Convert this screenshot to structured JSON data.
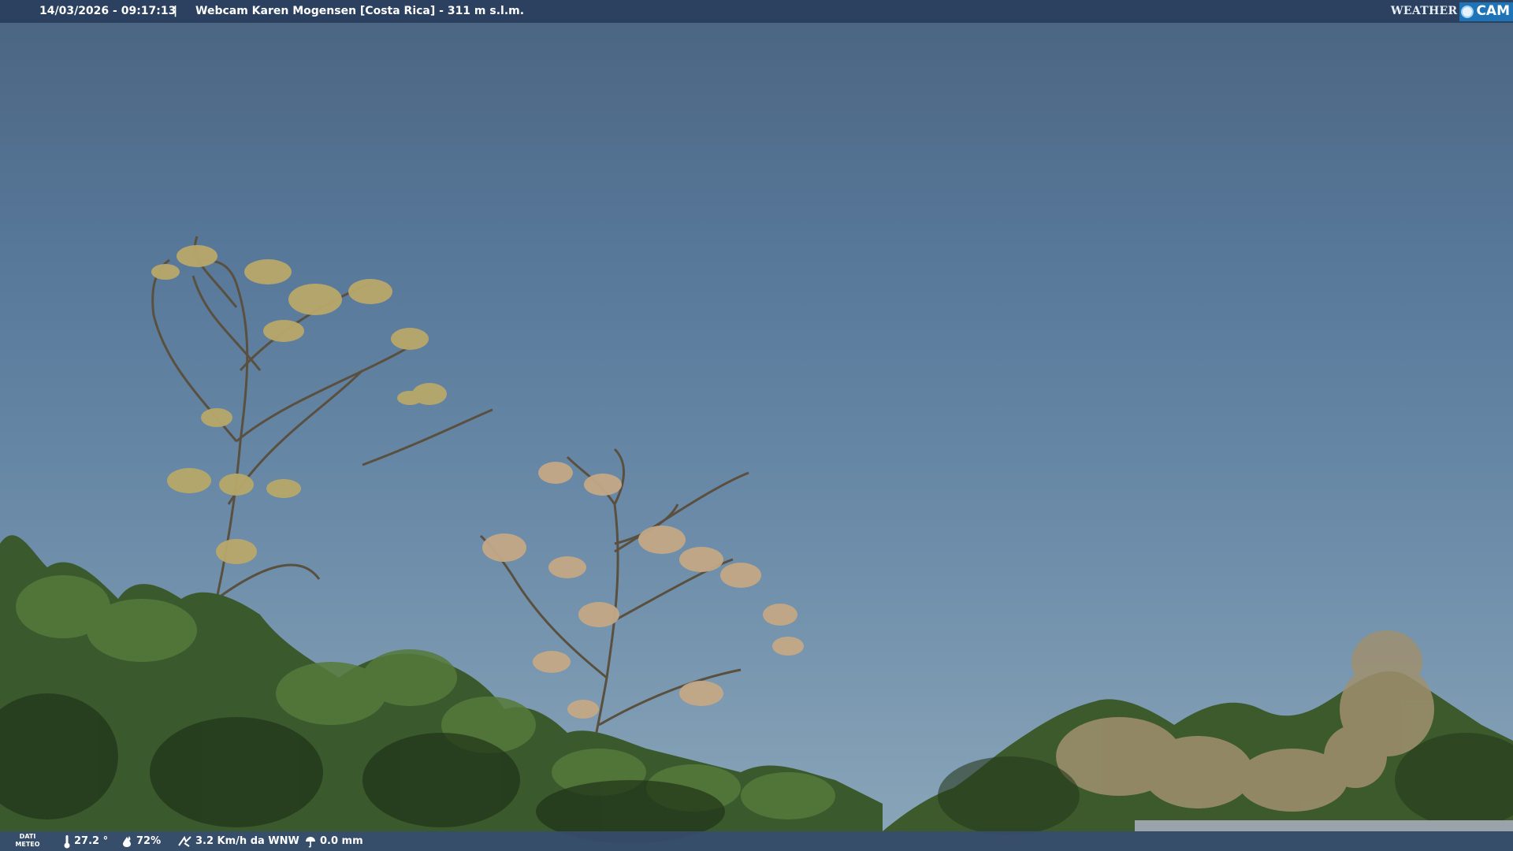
{
  "overlay": {
    "datetime": "14/03/2026 - 09:17:13",
    "separator": "|",
    "title": "Webcam Karen Mogensen [Costa Rica]  - 311 m s.l.m."
  },
  "logo": {
    "weather": "WEATHER",
    "cam": "CAM"
  },
  "meteo": {
    "label_line1": "DATI",
    "label_line2": "METEO",
    "temperature": "27.2 °",
    "humidity": "72%",
    "wind": "3.2 Km/h da WNW",
    "rain": "0.0 mm"
  },
  "icons": {
    "temperature": "thermometer-icon",
    "humidity": "humidity-drop-icon",
    "wind": "wind-icon",
    "rain": "rain-gauge-icon"
  },
  "colors": {
    "sky_top": "#4a6480",
    "sky_bottom": "#8aa6ba",
    "overlay_bar": "#283e5c",
    "logo_blue": "#1f74b8"
  }
}
